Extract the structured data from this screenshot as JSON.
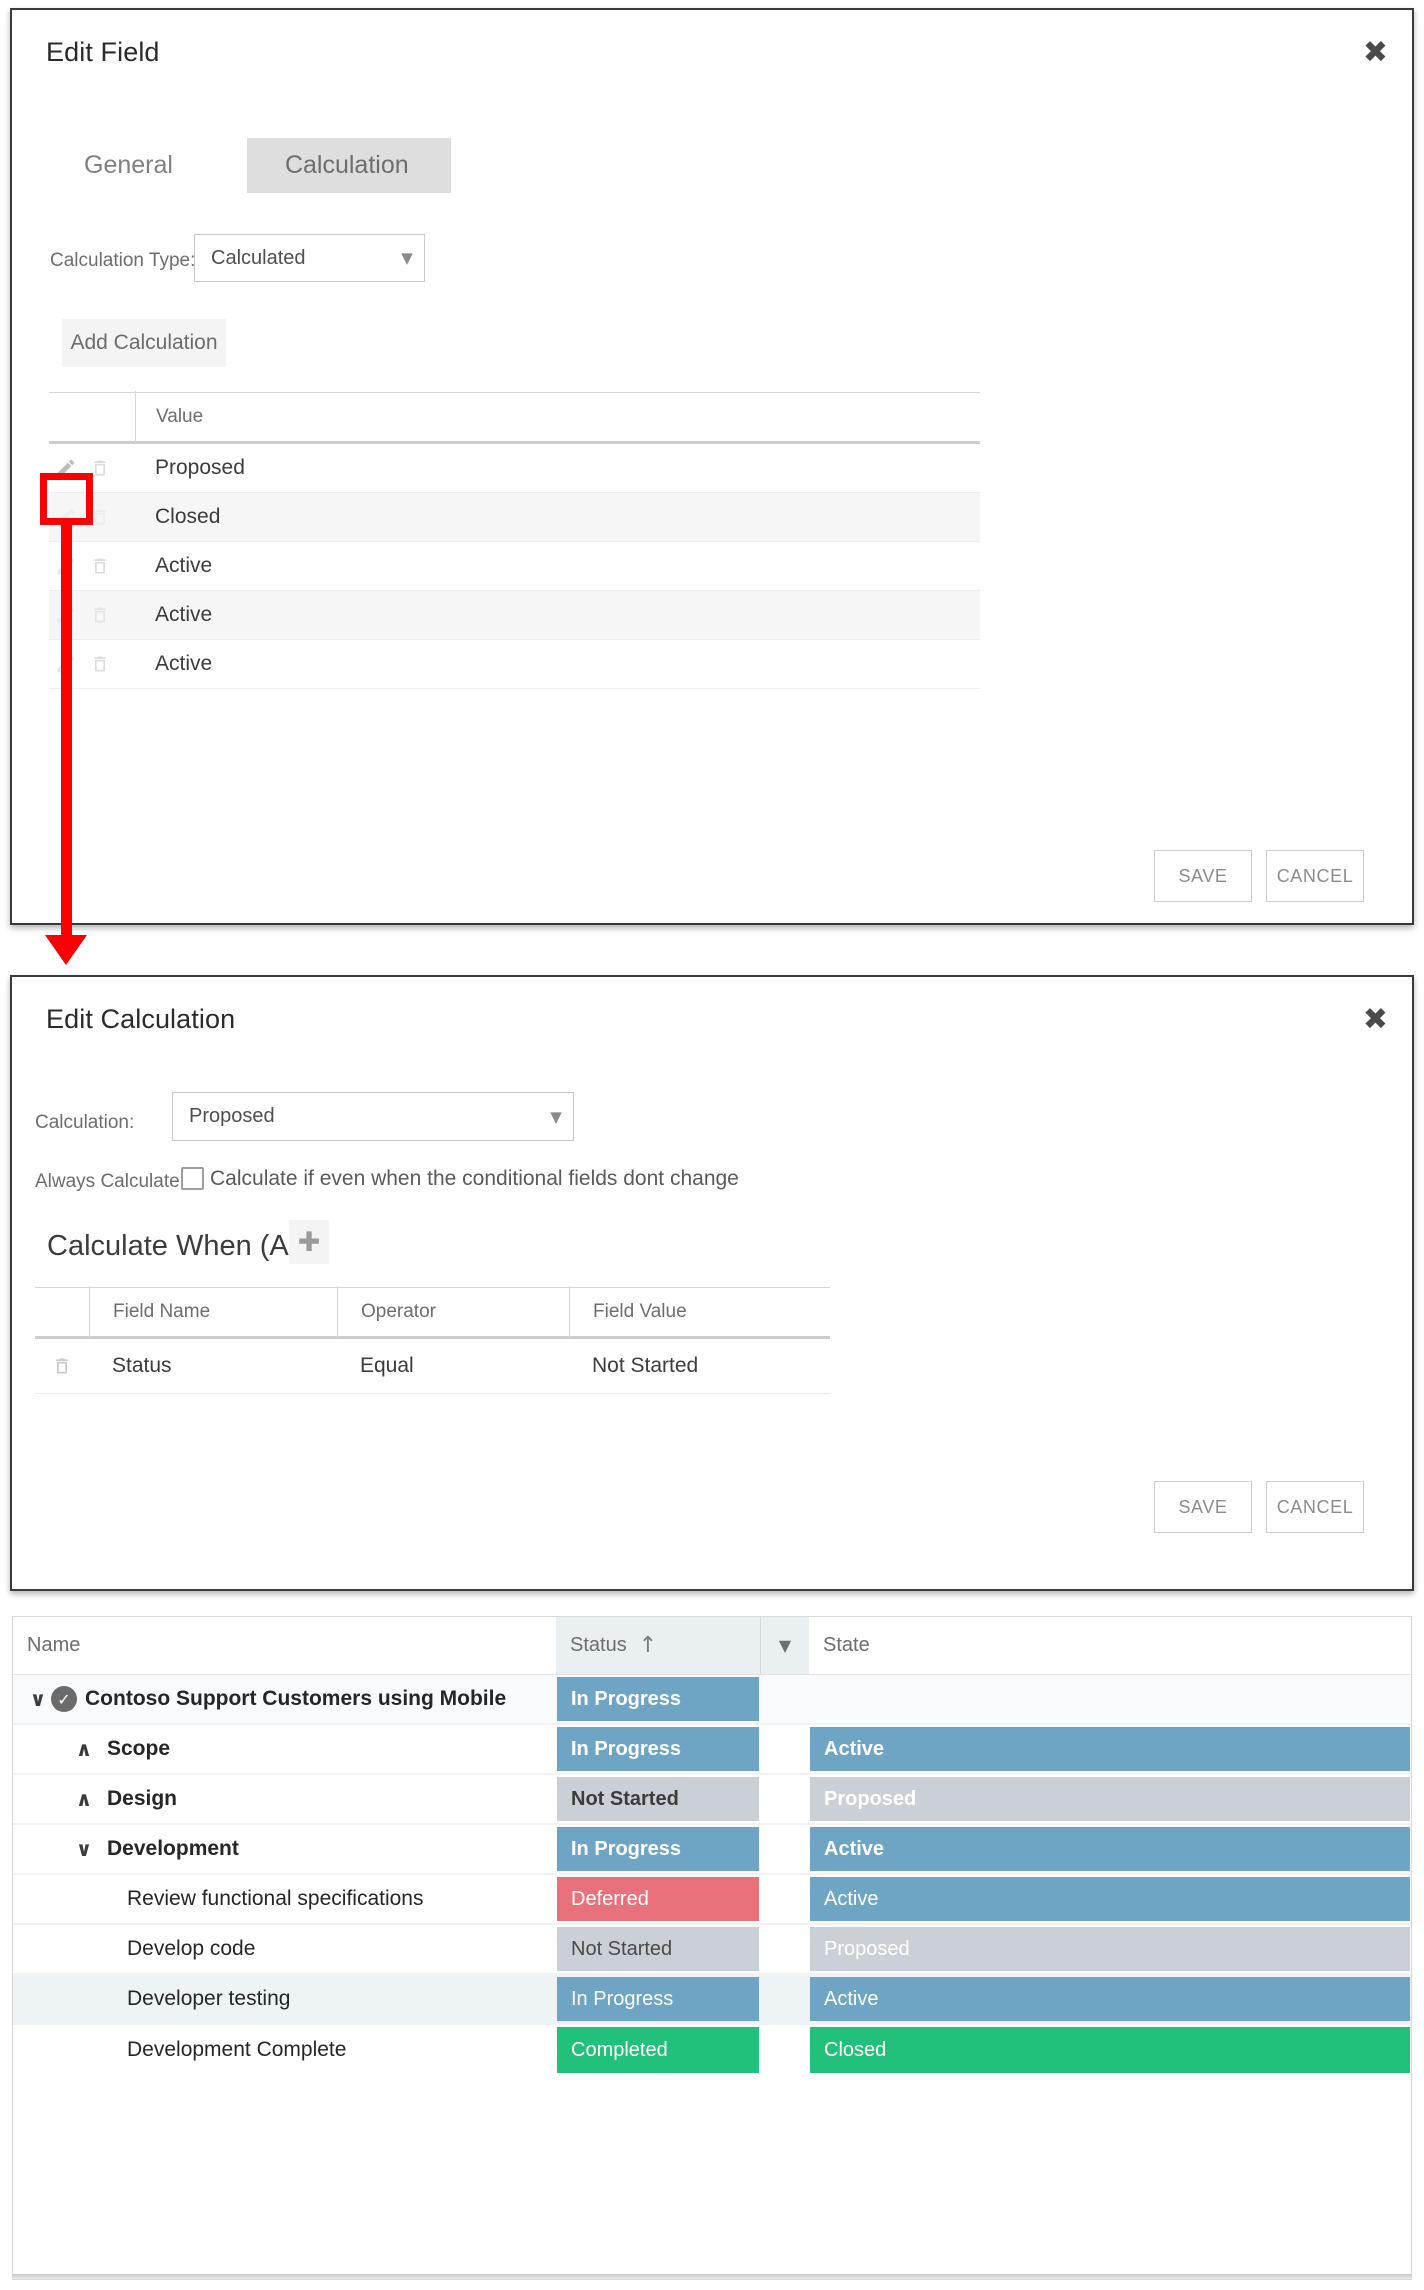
{
  "edit_field_dialog": {
    "title": "Edit Field",
    "close_label": "✖",
    "tabs": [
      {
        "label": "General",
        "active": false
      },
      {
        "label": "Calculation",
        "active": true
      }
    ],
    "calculation_type": {
      "label": "Calculation Type:",
      "value": "Calculated",
      "caret": "▼"
    },
    "add_calculation_label": "Add Calculation",
    "table": {
      "columns": [
        "",
        "Value"
      ],
      "rows": [
        {
          "value": "Proposed",
          "edit_icon": "pencil-icon",
          "delete_icon": "trash-icon"
        },
        {
          "value": "Closed",
          "edit_icon": "pencil-icon",
          "delete_icon": "trash-icon"
        },
        {
          "value": "Active",
          "edit_icon": "pencil-icon",
          "delete_icon": "trash-icon"
        },
        {
          "value": "Active",
          "edit_icon": "pencil-icon",
          "delete_icon": "trash-icon"
        },
        {
          "value": "Active",
          "edit_icon": "pencil-icon",
          "delete_icon": "trash-icon"
        }
      ]
    },
    "save_label": "SAVE",
    "cancel_label": "CANCEL"
  },
  "edit_calculation_dialog": {
    "title": "Edit Calculation",
    "close_label": "✖",
    "calculation": {
      "label": "Calculation:",
      "value": "Proposed",
      "caret": "▼"
    },
    "always_calculate": {
      "label": "Always Calculate:",
      "checkbox_text": "Calculate if even when the conditional fields dont change",
      "checked": false
    },
    "calculate_when": {
      "title": "Calculate When (And)",
      "add_icon": "plus-icon",
      "add_glyph": "✚",
      "columns": [
        "",
        "Field Name",
        "Operator",
        "Field Value"
      ],
      "rows": [
        {
          "field_name": "Status",
          "operator": "Equal",
          "field_value": "Not Started",
          "delete_icon": "trash-icon"
        }
      ]
    },
    "save_label": "SAVE",
    "cancel_label": "CANCEL"
  },
  "backlog_grid": {
    "columns": [
      {
        "label": "Name"
      },
      {
        "label": "Status",
        "sort_glyph": "↑",
        "sorted": true
      },
      {
        "label": "",
        "filter_glyph": "▼"
      },
      {
        "label": "State"
      }
    ],
    "rows": [
      {
        "name": "Contoso Support Customers using Mobile",
        "indent": 0,
        "chevron": "∨",
        "has_circle_check": true,
        "bold": true,
        "status": "In Progress",
        "status_color": "#6ea5c4",
        "status_text_color": "#ffffff",
        "state": "",
        "state_color": "transparent",
        "state_text_color": "#ffffff",
        "row_bg": "#f8fafb"
      },
      {
        "name": "Scope",
        "indent": 1,
        "chevron": "∧",
        "has_circle_check": false,
        "bold": true,
        "status": "In Progress",
        "status_color": "#6ea5c4",
        "status_text_color": "#ffffff",
        "state": "Active",
        "state_color": "#6ea5c4",
        "state_text_color": "#ffffff",
        "row_bg": "#ffffff"
      },
      {
        "name": "Design",
        "indent": 1,
        "chevron": "∧",
        "has_circle_check": false,
        "bold": true,
        "status": "Not Started",
        "status_color": "#cbcfd6",
        "status_text_color": "#3c3c3c",
        "state": "Proposed",
        "state_color": "#cbcfd6",
        "state_text_color": "#ffffff",
        "row_bg": "#ffffff"
      },
      {
        "name": "Development",
        "indent": 1,
        "chevron": "∨",
        "has_circle_check": false,
        "bold": true,
        "status": "In Progress",
        "status_color": "#6ea5c4",
        "status_text_color": "#ffffff",
        "state": "Active",
        "state_color": "#6ea5c4",
        "state_text_color": "#ffffff",
        "row_bg": "#ffffff"
      },
      {
        "name": "Review functional specifications",
        "indent": 2,
        "chevron": "",
        "has_circle_check": false,
        "bold": false,
        "status": "Deferred",
        "status_color": "#e8717c",
        "status_text_color": "#ffffff",
        "state": "Active",
        "state_color": "#6ea5c4",
        "state_text_color": "#ffffff",
        "row_bg": "#ffffff"
      },
      {
        "name": "Develop code",
        "indent": 2,
        "chevron": "",
        "has_circle_check": false,
        "bold": false,
        "status": "Not Started",
        "status_color": "#cbcfd6",
        "status_text_color": "#4a4a4a",
        "state": "Proposed",
        "state_color": "#cbcfd6",
        "state_text_color": "#ffffff",
        "row_bg": "#ffffff"
      },
      {
        "name": "Developer testing",
        "indent": 2,
        "chevron": "",
        "has_circle_check": false,
        "bold": false,
        "status": "In Progress",
        "status_color": "#6ea5c4",
        "status_text_color": "#ffffff",
        "state": "Active",
        "state_color": "#6ea5c4",
        "state_text_color": "#ffffff",
        "row_bg": "#eef4f6"
      },
      {
        "name": "Development Complete",
        "indent": 2,
        "chevron": "",
        "has_circle_check": false,
        "bold": false,
        "status": "Completed",
        "status_color": "#22c17b",
        "status_text_color": "#ffffff",
        "state": "Closed",
        "state_color": "#22c17b",
        "state_text_color": "#ffffff",
        "row_bg": "#ffffff"
      }
    ]
  },
  "annotation": {
    "highlight_icon": "pencil-icon",
    "color": "#fb0000",
    "arrow_glyph": "▼"
  }
}
